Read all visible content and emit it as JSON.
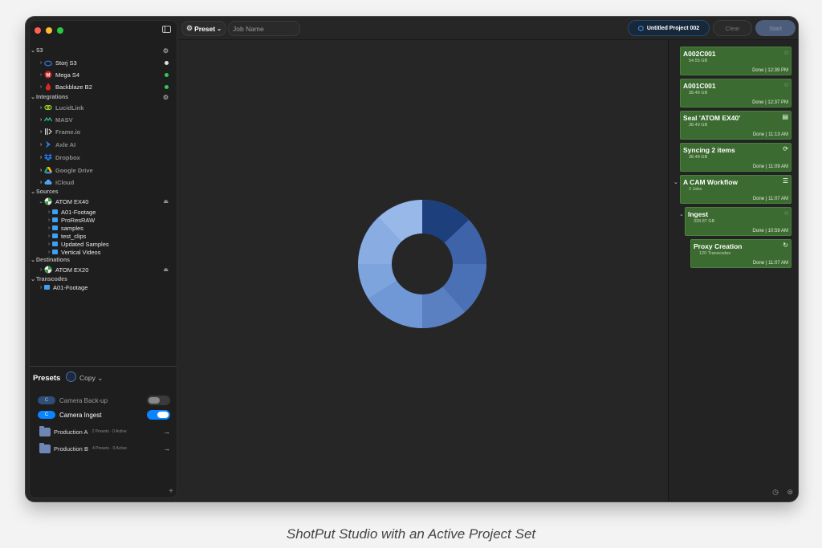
{
  "caption": "ShotPut Studio with an Active Project Set",
  "toolbar": {
    "preset_label": "Preset",
    "job_name_placeholder": "Job Name",
    "project_label": "Untitled Project 002",
    "clear_label": "Clear",
    "start_label": "Start"
  },
  "sidebar": {
    "sections": {
      "s3": "S3",
      "integrations": "Integrations",
      "sources": "Sources",
      "destinations": "Destinations",
      "transcodes": "Transcodes"
    },
    "s3_items": [
      {
        "label": "Storj S3",
        "status_color": "#e0e0e0"
      },
      {
        "label": "Mega S4",
        "status_color": "#34c759"
      },
      {
        "label": "Backblaze B2",
        "status_color": "#34c759"
      }
    ],
    "integrations": [
      "LucidLink",
      "MASV",
      "Frame.io",
      "Axle AI",
      "Dropbox",
      "Google Drive",
      "iCloud"
    ],
    "source": {
      "label": "ATOM EX40",
      "folders": [
        "A01-Footage",
        "ProResRAW",
        "samples",
        "test_clips",
        "Updated Samples",
        "Vertical Videos"
      ]
    },
    "destination": {
      "label": "ATOM EX20"
    },
    "transcode": {
      "folder": "A01-Footage"
    }
  },
  "presets": {
    "title": "Presets",
    "mode_label": "Copy",
    "items": [
      {
        "badge": "C",
        "label": "Camera Back-up",
        "enabled": false
      },
      {
        "badge": "C",
        "label": "Camera Ingest",
        "enabled": true
      }
    ],
    "folders": [
      {
        "label": "Production A",
        "meta": "2 Presets · 0 Active"
      },
      {
        "label": "Production B",
        "meta": "4 Presets · 0 Active"
      }
    ]
  },
  "jobs": [
    {
      "title": "A002C001",
      "meta": "54.55 GB",
      "status": "Done | 12:39 PM",
      "icon": "progress-ring-icon"
    },
    {
      "title": "A001C001",
      "meta": "38.48 GB",
      "status": "Done | 12:37 PM",
      "icon": "progress-ring-icon"
    },
    {
      "title": "Seal 'ATOM EX40'",
      "meta": "38.49 GB",
      "status": "Done | 11:13 AM",
      "icon": "document-seal-icon"
    },
    {
      "title": "Syncing 2 items",
      "meta": "38.48 GB",
      "status": "Done | 11:09 AM",
      "icon": "sync-icon"
    },
    {
      "title": "A CAM Workflow",
      "meta": "2 Jobs",
      "status": "Done | 11:07 AM",
      "icon": "workflow-icon"
    },
    {
      "title": "Ingest",
      "meta": "328.87 GB",
      "status": "Done | 10:59 AM",
      "icon": "progress-ring-icon"
    },
    {
      "title": "Proxy Creation",
      "meta": "120 Transcodes",
      "status": "Done | 11:07 AM",
      "icon": "transcode-icon"
    }
  ],
  "colors": {
    "job_green": "#3b6b30",
    "accent_blue": "#0a84ff",
    "logo_blue": "#6e94d4"
  }
}
